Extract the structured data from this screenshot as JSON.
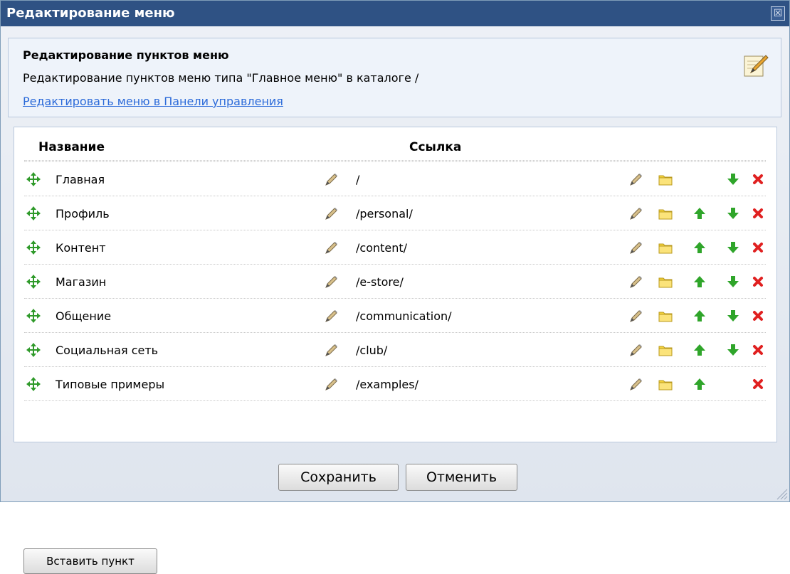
{
  "dialog": {
    "title": "Редактирование меню",
    "close_label": "☒"
  },
  "header": {
    "title": "Редактирование пунктов меню",
    "description": "Редактирование пунктов меню типа \"Главное меню\" в каталоге /",
    "link": "Редактировать меню в Панели управления"
  },
  "table": {
    "headers": {
      "name": "Название",
      "link": "Ссылка"
    },
    "rows": [
      {
        "name": "Главная",
        "link": "/",
        "up": false,
        "down": true
      },
      {
        "name": "Профиль",
        "link": "/personal/",
        "up": true,
        "down": true
      },
      {
        "name": "Контент",
        "link": "/content/",
        "up": true,
        "down": true
      },
      {
        "name": "Магазин",
        "link": "/e-store/",
        "up": true,
        "down": true
      },
      {
        "name": "Общение",
        "link": "/communication/",
        "up": true,
        "down": true
      },
      {
        "name": "Социальная сеть",
        "link": "/club/",
        "up": true,
        "down": true
      },
      {
        "name": "Типовые примеры",
        "link": "/examples/",
        "up": true,
        "down": false
      }
    ]
  },
  "buttons": {
    "insert": "Вставить пункт",
    "save": "Сохранить",
    "cancel": "Отменить"
  },
  "icons": {
    "drag": "move-arrows-icon",
    "edit": "pencil-icon",
    "folder": "folder-icon",
    "up": "arrow-up-icon",
    "down": "arrow-down-icon",
    "delete": "delete-x-icon"
  },
  "colors": {
    "titlebar": "#2f5284",
    "link": "#2b6ad9",
    "arrow_green": "#2fa52a",
    "delete_red": "#e02020",
    "folder_yellow": "#f5d33a"
  }
}
